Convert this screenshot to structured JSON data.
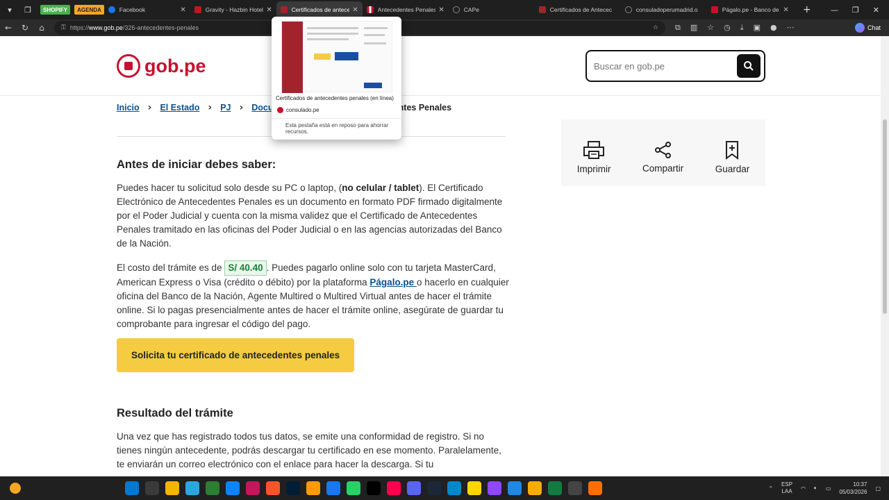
{
  "browser": {
    "tags": [
      "SHOPIFY",
      "AGENDA"
    ],
    "tabs": [
      {
        "label": "Facebook",
        "color": "#1877f2",
        "active": false
      },
      {
        "label": "Gravity - Hazbin Hotel |",
        "color": "#b71c1c",
        "active": false
      },
      {
        "label": "Certificados de antece",
        "color": "#a1242c",
        "active": true
      },
      {
        "label": "Antecedentes Penales -",
        "color": "#c8102e",
        "active": false
      },
      {
        "label": "CAPe",
        "color": "#888888",
        "active": false
      },
      {
        "label": "Certificados de Antecec",
        "color": "#a1242c",
        "active": false
      },
      {
        "label": "consuladoperumadrid.o",
        "color": "#777777",
        "active": false
      },
      {
        "label": "Págalo.pe - Banco de la",
        "color": "#c8102e",
        "active": false
      }
    ],
    "url_prefix": "https://",
    "url_domain": "www.gob.pe",
    "url_path": "/326-antecedentes-penales",
    "chat_label": "Chat"
  },
  "tooltip": {
    "title": "Certificados de antecedentes penales (en línea)",
    "site": "consulado.pe",
    "sleep_note": "Esta pestaña está en reposo para ahorrar recursos."
  },
  "header": {
    "brand": "gob.pe",
    "search_placeholder": "Buscar en gob.pe"
  },
  "breadcrumb": {
    "items": [
      "Inicio",
      "El Estado",
      "PJ",
      "Document"
    ],
    "current": "Antecedentes Penales"
  },
  "actions": {
    "print": "Imprimir",
    "share": "Compartir",
    "save": "Guardar"
  },
  "content": {
    "heading1": "Antes de iniciar debes saber:",
    "p1_a": "Puedes hacer tu solicitud solo desde su PC o laptop, (",
    "p1_bold": "no celular / tablet",
    "p1_b": "). El Certificado Electrónico de Antecedentes Penales es un documento en formato PDF firmado digitalmente por el Poder Judicial y cuenta con la misma validez que el Certificado de Antecedentes Penales tramitado en las oficinas del Poder Judicial o en las agencias autorizadas del Banco de la Nación.",
    "p2_a": "El costo del trámite es de ",
    "price": "S/ 40.40",
    "p2_b": ". Puedes pagarlo online solo con tu tarjeta MasterCard, American Express o Visa (crédito o débito) por la plataforma ",
    "p2_link": "Págalo.pe ",
    "p2_c": "o hacerlo en cualquier oficina del Banco de la Nación, Agente Multired o Multired Virtual antes de hacer el trámite online. Si lo pagas presencialmente antes de hacer el trámite online, asegúrate de guardar tu comprobante para ingresar el código del pago.",
    "cta": "Solicita tu certificado de antecedentes penales",
    "heading2": "Resultado del trámite",
    "p3": "Una vez que has registrado todos tus datos, se emite una conformidad de registro. Si no tienes ningún antecedente, podrás descargar tu certificado en ese momento. Paralelamente, te enviarán un correo electrónico con el enlace para hacer la descarga. Si tu"
  },
  "taskbar": {
    "lang_top": "ESP",
    "lang_bottom": "LAA",
    "time": "10:37",
    "date": "05/03/2026",
    "icon_colors": [
      "#0078d4",
      "#3a3a3a",
      "#f4b400",
      "#2aa7df",
      "#2e7d32",
      "#0a84ff",
      "#c2185b",
      "#fb542b",
      "#001e36",
      "#ff9a00",
      "#1877f2",
      "#25d366",
      "#000000",
      "#ff004f",
      "#5865f2",
      "#1b2838",
      "#0088cc",
      "#ffd700",
      "#9146ff",
      "#1e88e5",
      "#f9ab00",
      "#107c41",
      "#444444",
      "#ff6f00"
    ]
  }
}
